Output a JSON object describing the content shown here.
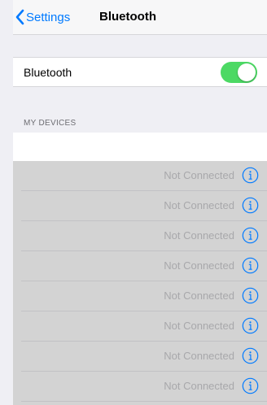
{
  "nav": {
    "back_label": "Settings",
    "title": "Bluetooth"
  },
  "bluetooth": {
    "label": "Bluetooth",
    "enabled": true,
    "toggle_color": "#4cd964"
  },
  "section": {
    "header": "MY DEVICES"
  },
  "devices": [
    {
      "status": "Not Connected",
      "icon": "info-icon"
    },
    {
      "status": "Not Connected",
      "icon": "info-icon"
    },
    {
      "status": "Not Connected",
      "icon": "info-icon"
    },
    {
      "status": "Not Connected",
      "icon": "info-icon"
    },
    {
      "status": "Not Connected",
      "icon": "info-icon"
    },
    {
      "status": "Not Connected",
      "icon": "info-icon"
    },
    {
      "status": "Not Connected",
      "icon": "info-icon"
    },
    {
      "status": "Not Connected",
      "icon": "info-icon"
    }
  ],
  "colors": {
    "accent": "#007aff",
    "background": "#efeff4",
    "device_list_overlay": "#d3d3d3"
  }
}
